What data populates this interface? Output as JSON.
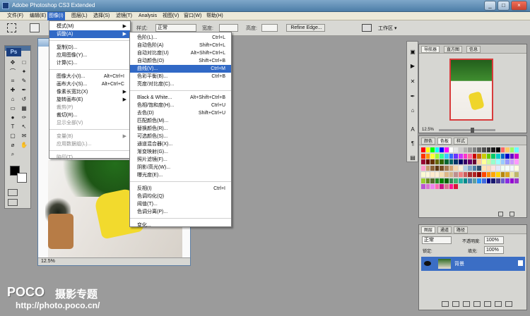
{
  "app": {
    "title": "Adobe Photoshop CS3 Extended"
  },
  "window_buttons": [
    "_",
    "□",
    "×"
  ],
  "menu": [
    "文件(F)",
    "编辑(E)",
    "图像(I)",
    "图层(L)",
    "选择(S)",
    "滤镜(T)",
    "Analysis",
    "视图(V)",
    "窗口(W)",
    "帮助(H)"
  ],
  "options": {
    "style_label": "样式:",
    "style_value": "正常",
    "width_label": "宽度:",
    "height_label": "高度:",
    "refine": "Refine Edge...",
    "workspace": "工作区 ▾"
  },
  "image_menu": [
    {
      "label": "模式(M)",
      "sub": true
    },
    {
      "label": "调整(A)",
      "sub": true,
      "active": true
    },
    {
      "sep": true
    },
    {
      "label": "复制(D)..."
    },
    {
      "label": "应用图像(Y)..."
    },
    {
      "label": "计算(C)..."
    },
    {
      "sep": true
    },
    {
      "label": "图像大小(I)...",
      "shortcut": "Alt+Ctrl+I"
    },
    {
      "label": "画布大小(S)...",
      "shortcut": "Alt+Ctrl+C"
    },
    {
      "label": "像素长宽比(X)",
      "sub": true
    },
    {
      "label": "旋转画布(E)",
      "sub": true
    },
    {
      "label": "裁剪(P)",
      "disabled": true
    },
    {
      "label": "裁切(R)..."
    },
    {
      "label": "显示全部(V)",
      "disabled": true
    },
    {
      "sep": true
    },
    {
      "label": "变量(B)",
      "disabled": true,
      "sub": true
    },
    {
      "label": "应用数据组(L)...",
      "disabled": true
    },
    {
      "sep": true
    },
    {
      "label": "陷印(T)...",
      "disabled": true
    }
  ],
  "adjust_menu": [
    {
      "label": "色阶(L)...",
      "shortcut": "Ctrl+L"
    },
    {
      "label": "自动色阶(A)",
      "shortcut": "Shift+Ctrl+L"
    },
    {
      "label": "自动对比度(U)",
      "shortcut": "Alt+Shift+Ctrl+L"
    },
    {
      "label": "自动颜色(O)",
      "shortcut": "Shift+Ctrl+B"
    },
    {
      "label": "曲线(V)...",
      "shortcut": "Ctrl+M",
      "active": true
    },
    {
      "label": "色彩平衡(B)...",
      "shortcut": "Ctrl+B"
    },
    {
      "label": "亮度/对比度(C)..."
    },
    {
      "sep": true
    },
    {
      "label": "Black & White...",
      "shortcut": "Alt+Shift+Ctrl+B"
    },
    {
      "label": "色相/饱和度(H)...",
      "shortcut": "Ctrl+U"
    },
    {
      "label": "去色(D)",
      "shortcut": "Shift+Ctrl+U"
    },
    {
      "label": "匹配颜色(M)..."
    },
    {
      "label": "替换颜色(R)..."
    },
    {
      "label": "可选颜色(S)..."
    },
    {
      "label": "通道混合器(X)..."
    },
    {
      "label": "渐变映射(G)..."
    },
    {
      "label": "照片滤镜(F)..."
    },
    {
      "label": "阴影/高光(W)..."
    },
    {
      "label": "曝光度(E)..."
    },
    {
      "sep": true
    },
    {
      "label": "反相(I)",
      "shortcut": "Ctrl+I"
    },
    {
      "label": "色调均化(Q)"
    },
    {
      "label": "阈值(T)..."
    },
    {
      "label": "色调分离(P)..."
    },
    {
      "sep": true
    },
    {
      "label": "变化..."
    }
  ],
  "document": {
    "zoom": "12.5%"
  },
  "navigator": {
    "tabs": [
      "导航器",
      "直方图",
      "信息"
    ],
    "zoom": "12.5%"
  },
  "swatches": {
    "tabs": [
      "颜色",
      "色板",
      "样式"
    ],
    "colors": [
      "#ff0000",
      "#ffff00",
      "#00ff00",
      "#00ffff",
      "#0000ff",
      "#ff00ff",
      "#ffffff",
      "#e6e6e6",
      "#cccccc",
      "#b3b3b3",
      "#999999",
      "#808080",
      "#666666",
      "#4d4d4d",
      "#333333",
      "#1a1a1a",
      "#000000",
      "#ff6666",
      "#ffcc66",
      "#99ff66",
      "#66ffff",
      "#ff3300",
      "#ff9900",
      "#ffff33",
      "#99ff33",
      "#33ff99",
      "#33ccff",
      "#3366ff",
      "#6633ff",
      "#cc33ff",
      "#ff33cc",
      "#ff6699",
      "#cc0000",
      "#cc6600",
      "#cccc00",
      "#66cc00",
      "#00cc66",
      "#00cccc",
      "#0066cc",
      "#0000cc",
      "#6600cc",
      "#cc00cc",
      "#990033",
      "#660000",
      "#663300",
      "#666600",
      "#336600",
      "#006633",
      "#006666",
      "#003366",
      "#000066",
      "#330066",
      "#660066",
      "#660033",
      "#ffcc99",
      "#ffff99",
      "#ccff99",
      "#99ffcc",
      "#99ffff",
      "#99ccff",
      "#9999ff",
      "#cc99ff",
      "#ff99ff",
      "#ff99cc",
      "#c69c6d",
      "#8c6239",
      "#603913",
      "#754c24",
      "#a67c52",
      "#d4a373",
      "#f6d8ae",
      "#faf0d7",
      "#b0d0e8",
      "#7fa7c9",
      "#4d7ea8",
      "#2f4f6f",
      "#ffe4b5",
      "#ffdab9",
      "#ffe4e1",
      "#e6e6fa",
      "#f0fff0",
      "#f5fffa",
      "#f0f8ff",
      "#ffffe0",
      "#fafad2",
      "#fff8dc",
      "#ffebcd",
      "#ffefd5",
      "#f5deb3",
      "#deb887",
      "#d2b48c",
      "#bc8f8f",
      "#f08080",
      "#cd5c5c",
      "#a52a2a",
      "#b22222",
      "#8b0000",
      "#ff4500",
      "#ff8c00",
      "#ffa500",
      "#ffd700",
      "#b8860b",
      "#daa520",
      "#eee8aa",
      "#bdb76b",
      "#9acd32",
      "#6b8e23",
      "#556b2f",
      "#228b22",
      "#008000",
      "#006400",
      "#2e8b57",
      "#3cb371",
      "#20b2aa",
      "#008b8b",
      "#4682b4",
      "#5f9ea0",
      "#1e90ff",
      "#4169e1",
      "#00008b",
      "#191970",
      "#483d8b",
      "#6a5acd",
      "#8a2be2",
      "#9400d3",
      "#9932cc",
      "#ba55d3",
      "#da70d6",
      "#ee82ee",
      "#ff69b4",
      "#c71585",
      "#db7093",
      "#ff1493",
      "#dc143c"
    ]
  },
  "layers": {
    "tabs": [
      "图层",
      "通道",
      "路径"
    ],
    "blend": "正常",
    "opacity_label": "不透明度:",
    "opacity": "100%",
    "lock_label": "锁定:",
    "fill_label": "填充:",
    "fill": "100%",
    "layer_name": "背景"
  },
  "watermark": {
    "brand": "POCO",
    "title": "摄影专题",
    "url": "http://photo.poco.cn/"
  }
}
